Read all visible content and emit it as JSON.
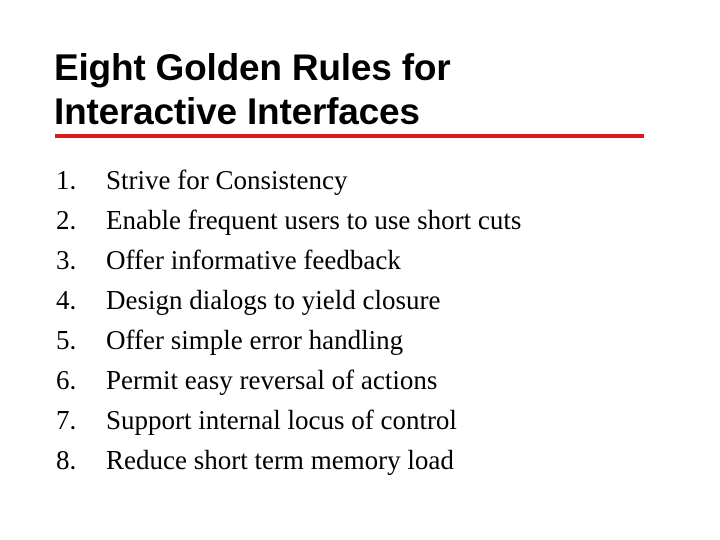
{
  "slide": {
    "background_color": "#ffffff",
    "accent_color": "#dd1a1a",
    "text_color": "#000000"
  },
  "title": {
    "line1": "Eight Golden Rules for",
    "line2": "Interactive Interfaces"
  },
  "rules": [
    {
      "number": "1.",
      "text": "Strive for Consistency"
    },
    {
      "number": "2.",
      "text": "Enable frequent users to use short cuts"
    },
    {
      "number": "3.",
      "text": "Offer informative feedback"
    },
    {
      "number": "4.",
      "text": "Design dialogs to yield closure"
    },
    {
      "number": "5.",
      "text": "Offer simple error handling"
    },
    {
      "number": "6.",
      "text": "Permit easy reversal of actions"
    },
    {
      "number": "7.",
      "text": "Support internal locus of control"
    },
    {
      "number": "8.",
      "text": "Reduce short term memory load"
    }
  ]
}
